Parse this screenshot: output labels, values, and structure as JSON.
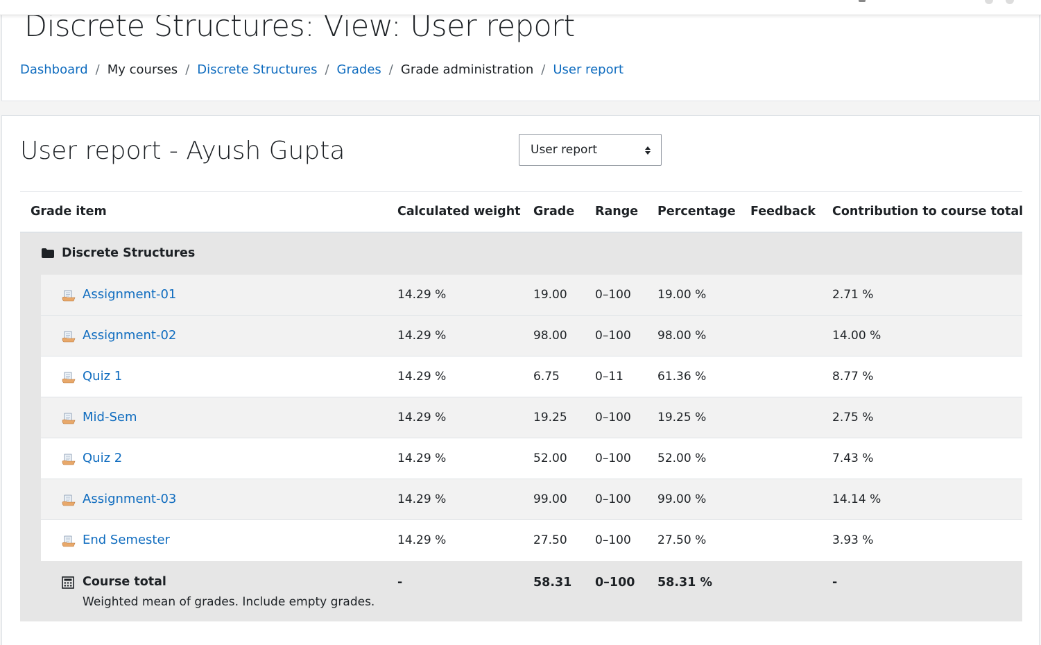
{
  "page": {
    "title": "Discrete Structures: View: User report"
  },
  "breadcrumb": [
    {
      "label": "Dashboard",
      "link": true
    },
    {
      "label": "My courses",
      "link": false
    },
    {
      "label": "Discrete Structures",
      "link": true
    },
    {
      "label": "Grades",
      "link": true
    },
    {
      "label": "Grade administration",
      "link": false
    },
    {
      "label": "User report",
      "link": true
    }
  ],
  "report": {
    "title": "User report - Ayush Gupta",
    "selector": {
      "value": "User report"
    }
  },
  "table": {
    "headers": {
      "item": "Grade item",
      "weight": "Calculated weight",
      "grade": "Grade",
      "range": "Range",
      "percentage": "Percentage",
      "feedback": "Feedback",
      "contribution": "Contribution to course total"
    },
    "category": "Discrete Structures",
    "rows": [
      {
        "name": "Assignment-01",
        "weight": "14.29 %",
        "grade": "19.00",
        "range": "0–100",
        "percentage": "19.00 %",
        "feedback": "",
        "contribution": "2.71 %"
      },
      {
        "name": "Assignment-02",
        "weight": "14.29 %",
        "grade": "98.00",
        "range": "0–100",
        "percentage": "98.00 %",
        "feedback": "",
        "contribution": "14.00 %"
      },
      {
        "name": "Quiz 1",
        "weight": "14.29 %",
        "grade": "6.75",
        "range": "0–11",
        "percentage": "61.36 %",
        "feedback": "",
        "contribution": "8.77 %"
      },
      {
        "name": "Mid-Sem",
        "weight": "14.29 %",
        "grade": "19.25",
        "range": "0–100",
        "percentage": "19.25 %",
        "feedback": "",
        "contribution": "2.75 %"
      },
      {
        "name": "Quiz 2",
        "weight": "14.29 %",
        "grade": "52.00",
        "range": "0–100",
        "percentage": "52.00 %",
        "feedback": "",
        "contribution": "7.43 %"
      },
      {
        "name": "Assignment-03",
        "weight": "14.29 %",
        "grade": "99.00",
        "range": "0–100",
        "percentage": "99.00 %",
        "feedback": "",
        "contribution": "14.14 %"
      },
      {
        "name": "End Semester",
        "weight": "14.29 %",
        "grade": "27.50",
        "range": "0–100",
        "percentage": "27.50 %",
        "feedback": "",
        "contribution": "3.93 %"
      }
    ],
    "total": {
      "label": "Course total",
      "description": "Weighted mean of grades. Include empty grades.",
      "weight": "-",
      "grade": "58.31",
      "range": "0–100",
      "percentage": "58.31 %",
      "contribution": "-"
    }
  },
  "colors": {
    "link": "#0f6cbf",
    "text": "#1d2125",
    "category_bg": "#e6e6e6",
    "row_alt_bg": "#f2f2f2"
  },
  "icons": {
    "category": "folder-icon",
    "item": "assignment-icon",
    "total": "calculator-icon",
    "selector": "sort-arrows-icon"
  }
}
